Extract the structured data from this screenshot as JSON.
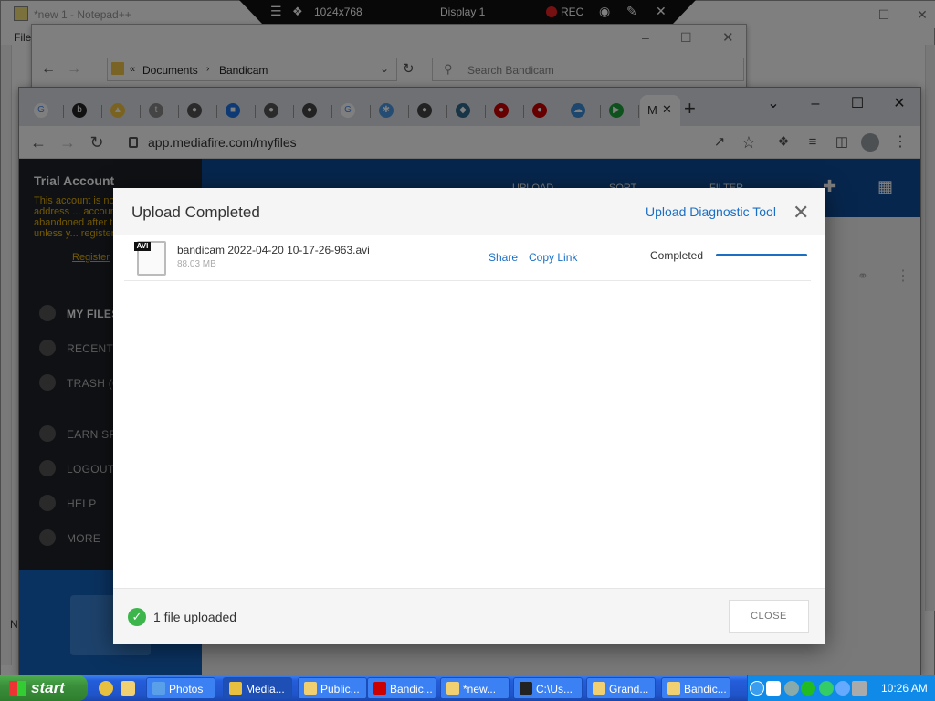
{
  "recorder": {
    "resolution": "1024x768",
    "display": "Display 1",
    "rec_label": "REC"
  },
  "notepad": {
    "title": "*new 1 - Notepad++",
    "menu_file": "File",
    "side_letter": "N"
  },
  "explorer": {
    "breadcrumb_root": "Documents",
    "breadcrumb_current": "Bandicam",
    "search_placeholder": "Search Bandicam"
  },
  "chrome": {
    "url": "app.mediafire.com/myfiles",
    "tabs": [
      {
        "icon": "google-icon",
        "glyph": "G"
      },
      {
        "icon": "bandcamp-icon",
        "glyph": "b"
      },
      {
        "icon": "drive-icon",
        "glyph": "▲"
      },
      {
        "icon": "audio-icon",
        "glyph": "t"
      },
      {
        "icon": "globe-icon",
        "glyph": "●"
      },
      {
        "icon": "bookmark-icon",
        "glyph": "■"
      },
      {
        "icon": "globe-icon",
        "glyph": "●"
      },
      {
        "icon": "chrome-icon",
        "glyph": "●"
      },
      {
        "icon": "google-icon",
        "glyph": "G"
      },
      {
        "icon": "photos-icon",
        "glyph": "✱"
      },
      {
        "icon": "chrome-icon",
        "glyph": "●"
      },
      {
        "icon": "shield-icon",
        "glyph": "◆"
      },
      {
        "icon": "record-icon",
        "glyph": "●"
      },
      {
        "icon": "record-icon",
        "glyph": "●"
      },
      {
        "icon": "cloud-icon",
        "glyph": "☁"
      },
      {
        "icon": "play-icon",
        "glyph": "▶"
      }
    ],
    "active_tab_label": "M"
  },
  "mediafire": {
    "trial_title": "Trial Account",
    "trial_text": "This account is no... an email address ... accounts may be ... abandoned after t... inactivity, unless y... register.",
    "register_link": "Register",
    "nav": [
      {
        "label": "MY FILES",
        "icon": "folder-icon"
      },
      {
        "label": "RECENT F",
        "icon": "clock-icon"
      },
      {
        "label": "TRASH (0",
        "icon": "trash-icon"
      },
      {
        "label": "EARN SP",
        "icon": "plus-icon"
      },
      {
        "label": "LOGOUT",
        "icon": "logout-icon"
      },
      {
        "label": "HELP",
        "icon": "help-icon"
      },
      {
        "label": "MORE",
        "icon": "more-icon"
      }
    ],
    "topbar": {
      "upload": "UPLOAD",
      "sort": "SORT",
      "filter": "FILTER"
    }
  },
  "modal": {
    "title": "Upload Completed",
    "diagnostic_link": "Upload Diagnostic Tool",
    "file": {
      "type_badge": "AVI",
      "name": "bandicam 2022-04-20 10-17-26-963.avi",
      "size": "88.03 MB",
      "share": "Share",
      "copy_link": "Copy Link",
      "status": "Completed",
      "progress": 1.0
    },
    "footer_text": "1 file uploaded",
    "close_label": "CLOSE"
  },
  "taskbar": {
    "start_label": "start",
    "tasks": [
      {
        "label": "Photos"
      },
      {
        "label": "Media..."
      },
      {
        "label": "Public..."
      },
      {
        "label": "Bandic..."
      },
      {
        "label": "*new..."
      },
      {
        "label": "C:\\Us..."
      },
      {
        "label": "Grand..."
      },
      {
        "label": "Bandic..."
      }
    ],
    "clock": "10:26 AM"
  }
}
